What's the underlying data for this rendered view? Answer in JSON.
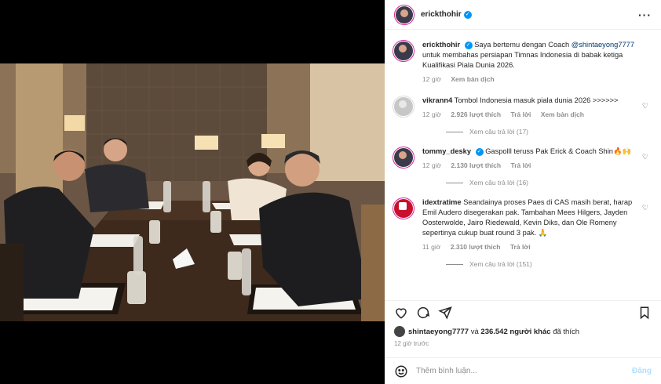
{
  "post": {
    "author": "erickthohir",
    "more_icon": "more-horizontal-icon"
  },
  "caption": {
    "author": "erickthohir",
    "text_before": "Saya bertemu dengan Coach ",
    "mention": "@shintaeyong7777",
    "text_after": " untuk membahas persiapan Timnas Indonesia di babak ketiga Kualifikasi Piala Dunia 2026.",
    "time": "12 giờ",
    "translate": "Xem bản dịch"
  },
  "comments": [
    {
      "user": "vikrann4",
      "text": "Tombol Indonesia masuk piala dunia 2026 >>>>>>",
      "time": "12 giờ",
      "likes": "2.926 lượt thích",
      "reply": "Trả lời",
      "translate": "Xem bản dịch",
      "replies": "Xem câu trả lời (17)"
    },
    {
      "user": "tommy_desky",
      "text": "Gaspolll teruss Pak Erick & Coach Shin🔥🙌",
      "time": "12 giờ",
      "likes": "2.130 lượt thích",
      "reply": "Trả lời",
      "replies": "Xem câu trả lời (16)"
    },
    {
      "user": "idextratime",
      "text": "Seandainya proses Paes di CAS masih berat, harap Emil Audero disegerakan pak. Tambahan Mees Hilgers, Jayden Oosterwolde, Jairo Riedewald, Kevin Diks, dan Ole Romeny sepertinya cukup buat round 3 pak. 🙏",
      "time": "11 giờ",
      "likes": "2.310 lượt thích",
      "reply": "Trả lời",
      "replies": "Xem câu trả lời (151)"
    }
  ],
  "likes_line": {
    "user": "shintaeyong7777",
    "connector": " và ",
    "count": "236.542 người khác",
    "suffix": " đã thích"
  },
  "posted_time": "12 giờ trước",
  "comment_box": {
    "placeholder": "Thêm bình luận...",
    "post_label": "Đăng"
  },
  "colors": {
    "accent": "#0095f6",
    "mention": "#00376b"
  }
}
